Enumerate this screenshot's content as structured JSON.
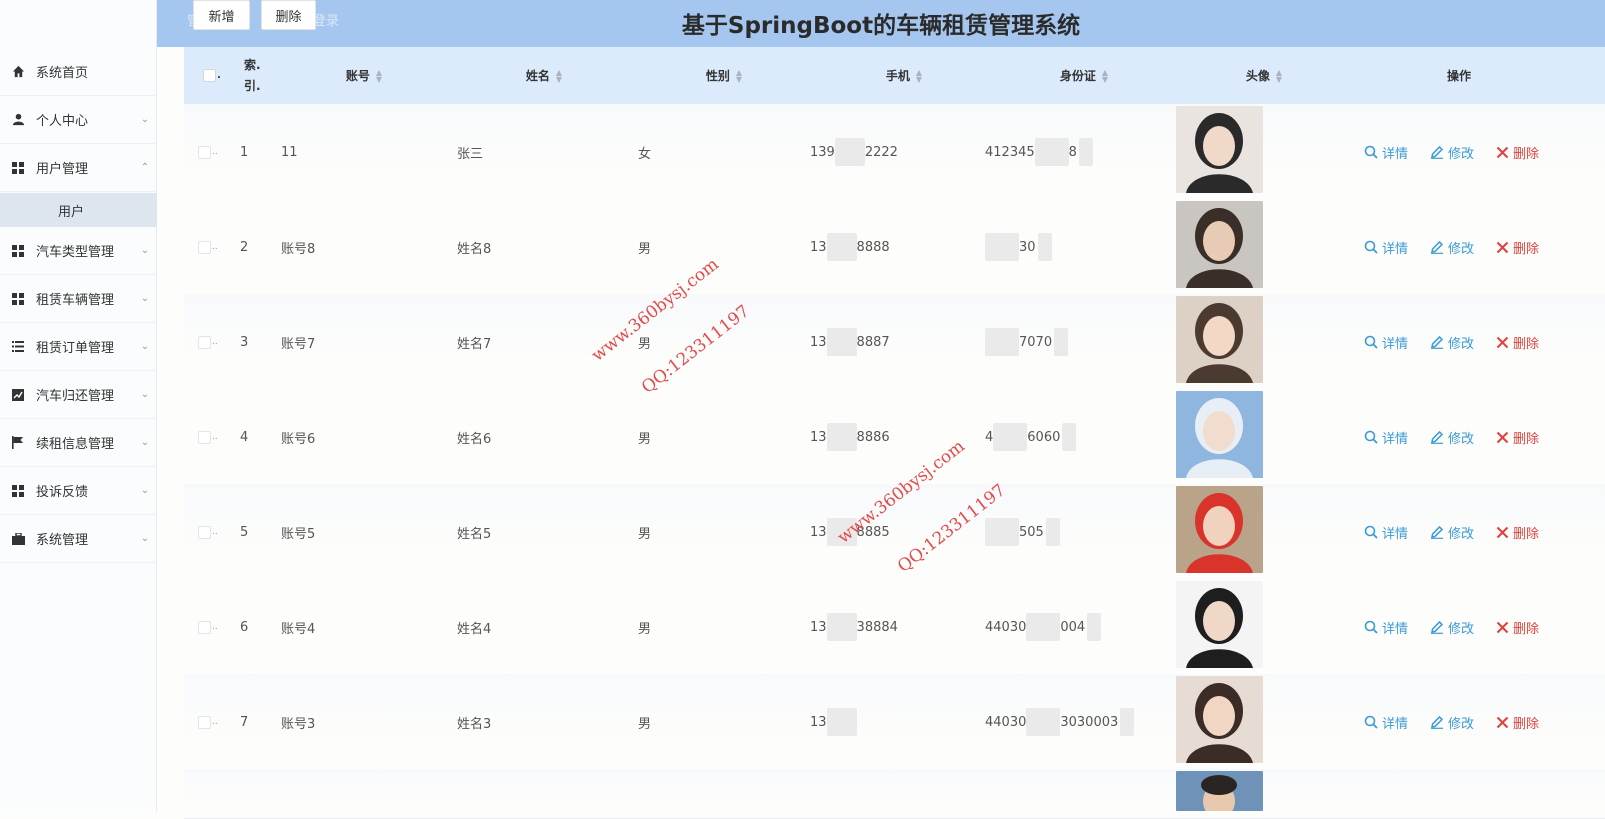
{
  "header": {
    "title": "基于SpringBoot的车辆租赁管理系统",
    "add_label": "新增",
    "delete_label": "删除",
    "faint_text_left": "管",
    "faint_text_right": "登录"
  },
  "sidebar": {
    "items": [
      {
        "label": "系统首页",
        "icon": "home-icon"
      },
      {
        "label": "个人中心",
        "icon": "user-icon"
      },
      {
        "label": "用户管理",
        "icon": "grid-icon"
      },
      {
        "label": "汽车类型管理",
        "icon": "grid-icon"
      },
      {
        "label": "租赁车辆管理",
        "icon": "grid-icon"
      },
      {
        "label": "租赁订单管理",
        "icon": "list-icon"
      },
      {
        "label": "汽车归还管理",
        "icon": "chart-icon"
      },
      {
        "label": "续租信息管理",
        "icon": "flag-icon"
      },
      {
        "label": "投诉反馈",
        "icon": "grid-icon"
      },
      {
        "label": "系统管理",
        "icon": "briefcase-icon"
      }
    ],
    "submenu": {
      "label": "用户"
    }
  },
  "table": {
    "headers": {
      "index": "索引",
      "index_line1": "索.",
      "index_line2": "引.",
      "account": "账号",
      "name": "姓名",
      "gender": "性别",
      "phone": "手机",
      "idcard": "身份证",
      "avatar": "头像",
      "ops": "操作"
    },
    "rows": [
      {
        "index": "1",
        "account": "11",
        "name": "张三",
        "gender": "女",
        "phone_start": "139",
        "phone_end": "2222",
        "id_start": "412345",
        "id_end": "8"
      },
      {
        "index": "2",
        "account": "账号8",
        "name": "姓名8",
        "gender": "男",
        "phone_start": "13",
        "phone_end": "8888",
        "id_start": "",
        "id_end": "30"
      },
      {
        "index": "3",
        "account": "账号7",
        "name": "姓名7",
        "gender": "男",
        "phone_start": "13",
        "phone_end": "8887",
        "id_start": "",
        "id_end": "7070"
      },
      {
        "index": "4",
        "account": "账号6",
        "name": "姓名6",
        "gender": "男",
        "phone_start": "13",
        "phone_end": "8886",
        "id_start": "4",
        "id_end": "6060"
      },
      {
        "index": "5",
        "account": "账号5",
        "name": "姓名5",
        "gender": "男",
        "phone_start": "13",
        "phone_end": "8885",
        "id_start": "",
        "id_end": "505"
      },
      {
        "index": "6",
        "account": "账号4",
        "name": "姓名4",
        "gender": "男",
        "phone_start": "13",
        "phone_end": "38884",
        "id_start": "44030",
        "id_end": "004"
      },
      {
        "index": "7",
        "account": "账号3",
        "name": "姓名3",
        "gender": "男",
        "phone_start": "13",
        "phone_end": "",
        "id_start": "44030",
        "id_end": "3030003"
      }
    ],
    "actions": {
      "detail": "详情",
      "edit": "修改",
      "delete": "删除"
    }
  },
  "watermarks": [
    {
      "site": "www.360bysj.com",
      "qq": "QQ:123311197"
    },
    {
      "site": "www.360bysj.com",
      "qq": "QQ:123311197"
    }
  ],
  "colors": {
    "header_bg": "#a5c7ef",
    "accent": "#3a9bd6",
    "danger": "#e0423d"
  }
}
